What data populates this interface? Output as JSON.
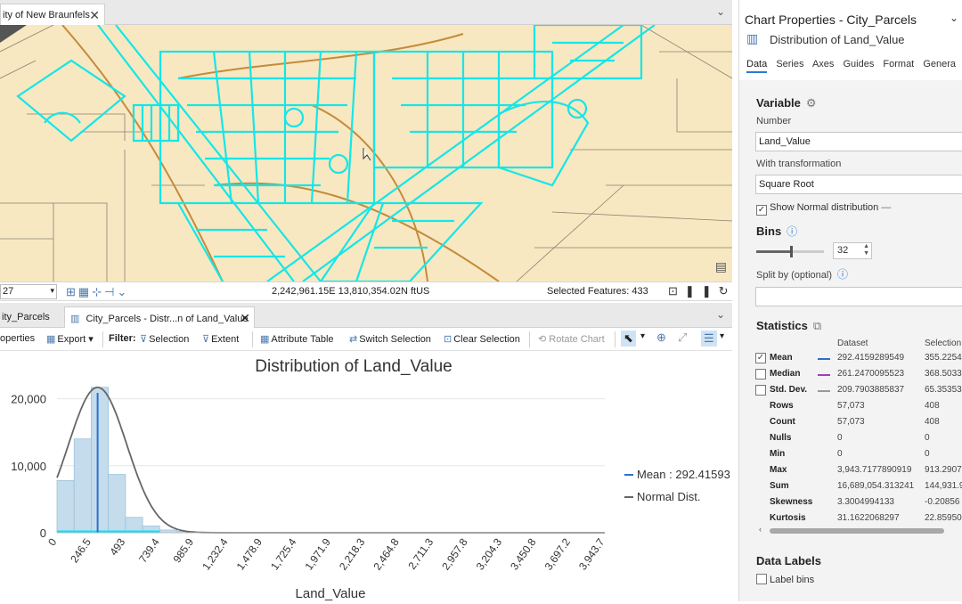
{
  "map_tab": {
    "title": "ity of New Braunfels",
    "close": "✕"
  },
  "map_status": {
    "scale": "27",
    "coords": "2,242,961.15E 13,810,354.02N ftUS",
    "selected": "Selected Features: 433"
  },
  "chart_tabs": {
    "tab1": "ity_Parcels",
    "tab2": "City_Parcels - Distr...n of Land_Value",
    "close": "✕"
  },
  "chart_toolbar": {
    "properties": "operties",
    "export": "Export",
    "filter": "Filter:",
    "selection": "Selection",
    "extent": "Extent",
    "attribute_table": "Attribute Table",
    "switch_selection": "Switch Selection",
    "clear_selection": "Clear Selection",
    "rotate_chart": "Rotate Chart"
  },
  "chart_data": {
    "type": "bar",
    "title": "Distribution of Land_Value",
    "xlabel": "Land_Value",
    "ylabel": "",
    "x_ticks": [
      "0",
      "246.5",
      "493",
      "739.4",
      "985.9",
      "1,232.4",
      "1,478.9",
      "1,725.4",
      "1,971.9",
      "2,218.3",
      "2,464.8",
      "2,711.3",
      "2,957.8",
      "3,204.3",
      "3,450.8",
      "3,697.2",
      "3,943.7"
    ],
    "y_ticks": [
      "0",
      "10,000",
      "20,000"
    ],
    "xlim": [
      0,
      3943.7
    ],
    "ylim": [
      0,
      23000
    ],
    "bin_width": 123.24,
    "bin_counts": [
      7800,
      14000,
      21700,
      8700,
      2300,
      1000,
      400,
      200,
      100,
      60,
      40,
      30,
      20,
      15,
      10,
      10,
      8,
      6,
      5,
      4,
      3,
      3,
      2,
      2,
      2,
      1,
      1,
      1,
      1,
      1,
      1,
      1
    ],
    "mean": 292.41593,
    "normal_peak": 21700,
    "normal_sd": 209.79,
    "legend": [
      {
        "label": "Mean : 292.41593",
        "color": "#2f6fce"
      },
      {
        "label": "Normal Dist.",
        "color": "#666666"
      }
    ],
    "colors": {
      "bar_fill": "#c5dcec",
      "bar_stroke": "#9cc3dc",
      "mean": "#2f6fce",
      "normal": "#666666",
      "selection": "#00e5ff"
    }
  },
  "panel": {
    "title": "Chart Properties - City_Parcels",
    "subtitle": "Distribution of Land_Value",
    "tabs": [
      "Data",
      "Series",
      "Axes",
      "Guides",
      "Format",
      "Genera"
    ],
    "variable_head": "Variable",
    "number_label": "Number",
    "number_value": "Land_Value",
    "transform_label": "With transformation",
    "transform_value": "Square Root",
    "show_normal": "Show Normal distribution",
    "bins_head": "Bins",
    "bins_value": "32",
    "split_label": "Split by (optional)",
    "stats_head": "Statistics",
    "col_dataset": "Dataset",
    "col_selection": "Selection",
    "stats": [
      {
        "name": "Mean",
        "dataset": "292.4159289549",
        "selection": "355.2254",
        "checked": true,
        "color": "#2f6fce"
      },
      {
        "name": "Median",
        "dataset": "261.2470095523",
        "selection": "368.5033",
        "checked": false,
        "color": "#a040c0"
      },
      {
        "name": "Std. Dev.",
        "dataset": "209.7903885837",
        "selection": "65.35353",
        "checked": false,
        "color": "#999999"
      },
      {
        "name": "Rows",
        "dataset": "57,073",
        "selection": "408"
      },
      {
        "name": "Count",
        "dataset": "57,073",
        "selection": "408"
      },
      {
        "name": "Nulls",
        "dataset": "0",
        "selection": "0"
      },
      {
        "name": "Min",
        "dataset": "0",
        "selection": "0"
      },
      {
        "name": "Max",
        "dataset": "3,943.7177890919",
        "selection": "913.2907"
      },
      {
        "name": "Sum",
        "dataset": "16,689,054.313241",
        "selection": "144,931.9"
      },
      {
        "name": "Skewness",
        "dataset": "3.3004994133",
        "selection": "-0.20856"
      },
      {
        "name": "Kurtosis",
        "dataset": "31.1622068297",
        "selection": "22.85950"
      }
    ],
    "data_labels_head": "Data Labels",
    "label_bins": "Label bins"
  }
}
